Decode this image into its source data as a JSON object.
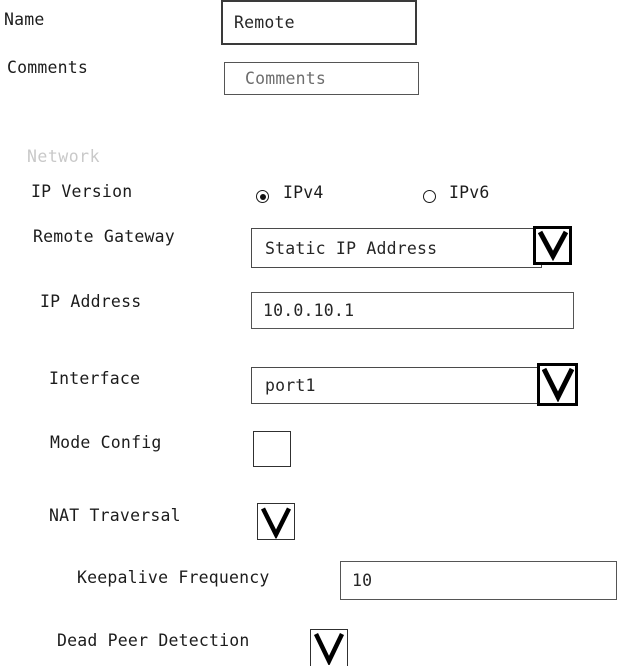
{
  "form": {
    "fields": {
      "name": {
        "label": "Name",
        "value": "Remote",
        "placeholder": "Name"
      },
      "comments": {
        "label": "Comments",
        "value": "Comments",
        "placeholder": "Comments",
        "is_placeholder": true
      }
    },
    "sections": [
      {
        "title": "Network",
        "rows": {
          "ip_version": {
            "label": "IP Version",
            "options": [
              {
                "label": "IPv4",
                "selected": true
              },
              {
                "label": "IPv6",
                "selected": false
              }
            ]
          },
          "remote_gateway": {
            "label": "Remote Gateway",
            "value": "Static IP Address",
            "icon": "chevron-down-icon"
          },
          "ip_address": {
            "label": "IP Address",
            "value": "10.0.10.1",
            "placeholder": "IP Address"
          },
          "interface": {
            "label": "Interface",
            "value": "port1",
            "icon": "chevron-down-icon"
          },
          "mode_config": {
            "label": "Mode Config",
            "checked": false
          },
          "nat_traversal": {
            "label": "NAT Traversal",
            "checked": true
          },
          "keepalive_frequency": {
            "label": "Keepalive Frequency",
            "value": "10",
            "placeholder": "Keepalive Frequency"
          },
          "dead_peer_detection": {
            "label": "Dead Peer Detection",
            "checked": true
          }
        }
      }
    ]
  },
  "colors": {
    "text": "#1c1c1c",
    "section_header": "#c9c9c9",
    "border": "#3a3a3a",
    "accent": "#000000",
    "background": "#ffffff"
  }
}
